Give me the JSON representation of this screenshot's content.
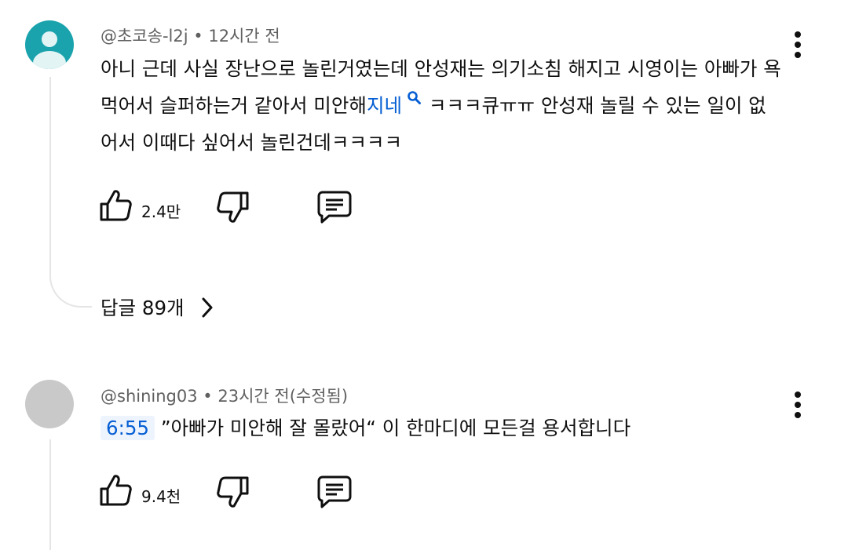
{
  "comments": [
    {
      "author": "@초코송-l2j",
      "time": "12시간 전",
      "text_before_link": "아니 근데 사실 장난으로 놀린거였는데 안성재는 의기소침 해지고 시영이는 아빠가 욕 먹어서 슬퍼하는거 같아서 미안해",
      "link_text": "지네",
      "text_after_link": " ㅋㅋㅋ큐ㅠㅠ 안성재 놀릴 수 있는 일이 없어서 이때다 싶어서 놀린건데ㅋㅋㅋㅋ",
      "likes": "2.4만",
      "replies": "답글 89개"
    },
    {
      "author": "@shining03",
      "time": "23시간 전(수정됨)",
      "timestamp_link": "6:55",
      "text": " ”아빠가 미안해 잘 몰랐어“ 이 한마디에 모든걸 용서합니다",
      "likes": "9.4천"
    }
  ],
  "icons": {
    "like": "thumbs-up-icon",
    "dislike": "thumbs-down-icon",
    "reply": "comment-icon",
    "more": "more-vertical-icon",
    "search": "search-icon",
    "chevron": "chevron-right-icon"
  },
  "colors": {
    "avatar1": "#1aa3ad",
    "avatar2": "#c9c9c9",
    "link": "#065fd4",
    "meta": "#606060"
  }
}
